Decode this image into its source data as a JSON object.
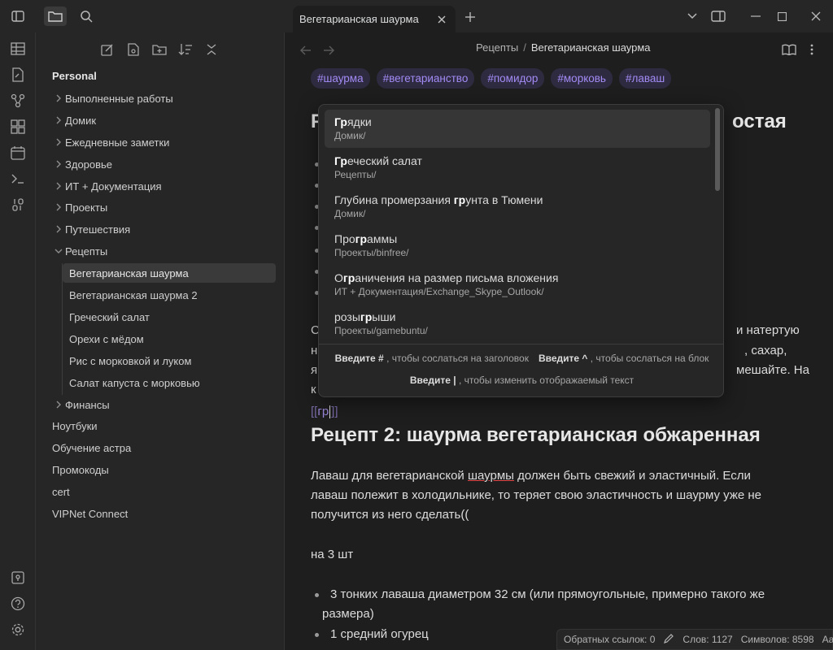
{
  "tab": {
    "title": "Вегетарианская шаурма"
  },
  "breadcrumb": {
    "parent": "Рецепты",
    "separator": "/",
    "current": "Вегетарианская шаурма"
  },
  "sidebar": {
    "vault": "Personal",
    "folders": [
      "Выполненные работы",
      "Домик",
      "Ежедневные заметки",
      "Здоровье",
      "ИТ + Документация",
      "Проекты",
      "Путешествия",
      "Рецепты"
    ],
    "recipes": [
      "Вегетарианская шаурма",
      "Вегетарианская шаурма 2",
      "Греческий салат",
      "Орехи с мёдом",
      "Рис с морковкой и луком",
      "Салат капуста с морковью"
    ],
    "after_folder": "Финансы",
    "root_files": [
      "Ноутбуки",
      "Обучение астра",
      "Промокоды",
      "cert",
      "VIPNet Connect"
    ]
  },
  "tags": [
    "#шаурма",
    "#вегетарианство",
    "#помидор",
    "#морковь",
    "#лаваш"
  ],
  "doc": {
    "h1_a_start": "Р",
    "h1_a_end": "остая",
    "para1_line1_start": "С",
    "para1_line1_end": "и натертую",
    "para1_line2_start": "н",
    "para1_line2_end": ", сахар,",
    "para1_line3_start": "я",
    "para1_line3_end": "мешайте. На",
    "para1_line4_start": "к",
    "link_open": "[[",
    "link_typed": "гр",
    "link_close": "]]",
    "h1_b": "Рецепт 2: шаурма вегетарианская обжаренная",
    "p2_line1_a": "Лаваш для вегетарианской ",
    "p2_line1_b": "шаурмы",
    "p2_line1_c": " должен быть свежий и эластичный. Если",
    "p2_line2": "лаваш полежит в холодильнике, то теряет свою эластичность и шаурму уже не",
    "p2_line3": "получится из него сделать((",
    "p3": "на 3 шт",
    "bullet1_line1": "3 тонких лаваша диаметром 32 см (или прямоугольные, примерно такого же",
    "bullet1_line2": "размера)",
    "bullet2": "1 средний огурец"
  },
  "suggest": {
    "items": [
      {
        "pre": "",
        "match": "Гр",
        "post": "ядки",
        "path": "Домик/"
      },
      {
        "pre": "",
        "match": "Гр",
        "post": "еческий салат",
        "path": "Рецепты/"
      },
      {
        "pre": "Глубина промерзания ",
        "match": "гр",
        "post": "унта в Тюмени",
        "path": "Домик/"
      },
      {
        "pre": "Про",
        "match": "гр",
        "post": "аммы",
        "path": "Проекты/binfree/"
      },
      {
        "pre": "О",
        "match": "гр",
        "post": "аничения на размер письма вложения",
        "path": "ИТ + Документация/Exchange_Skype_Outlook/"
      },
      {
        "pre": "розы",
        "match": "гр",
        "post": "ыши",
        "path": "Проекты/gamebuntu/"
      }
    ],
    "hint1_key": "Введите #",
    "hint1_text": ", чтобы сослаться на заголовок",
    "hint2_key": "Введите ^",
    "hint2_text": ", чтобы сослаться на блок",
    "hint3_key": "Введите |",
    "hint3_text": ", чтобы изменить отображаемый текст"
  },
  "status": {
    "backlinks": "Обратных ссылок: 0",
    "words": "Слов: 1127",
    "chars": "Символов: 8598",
    "lang": "Aa"
  },
  "colors": {
    "accent": "#a38bf5",
    "background": "#1e1e1e",
    "panel": "#262626"
  }
}
